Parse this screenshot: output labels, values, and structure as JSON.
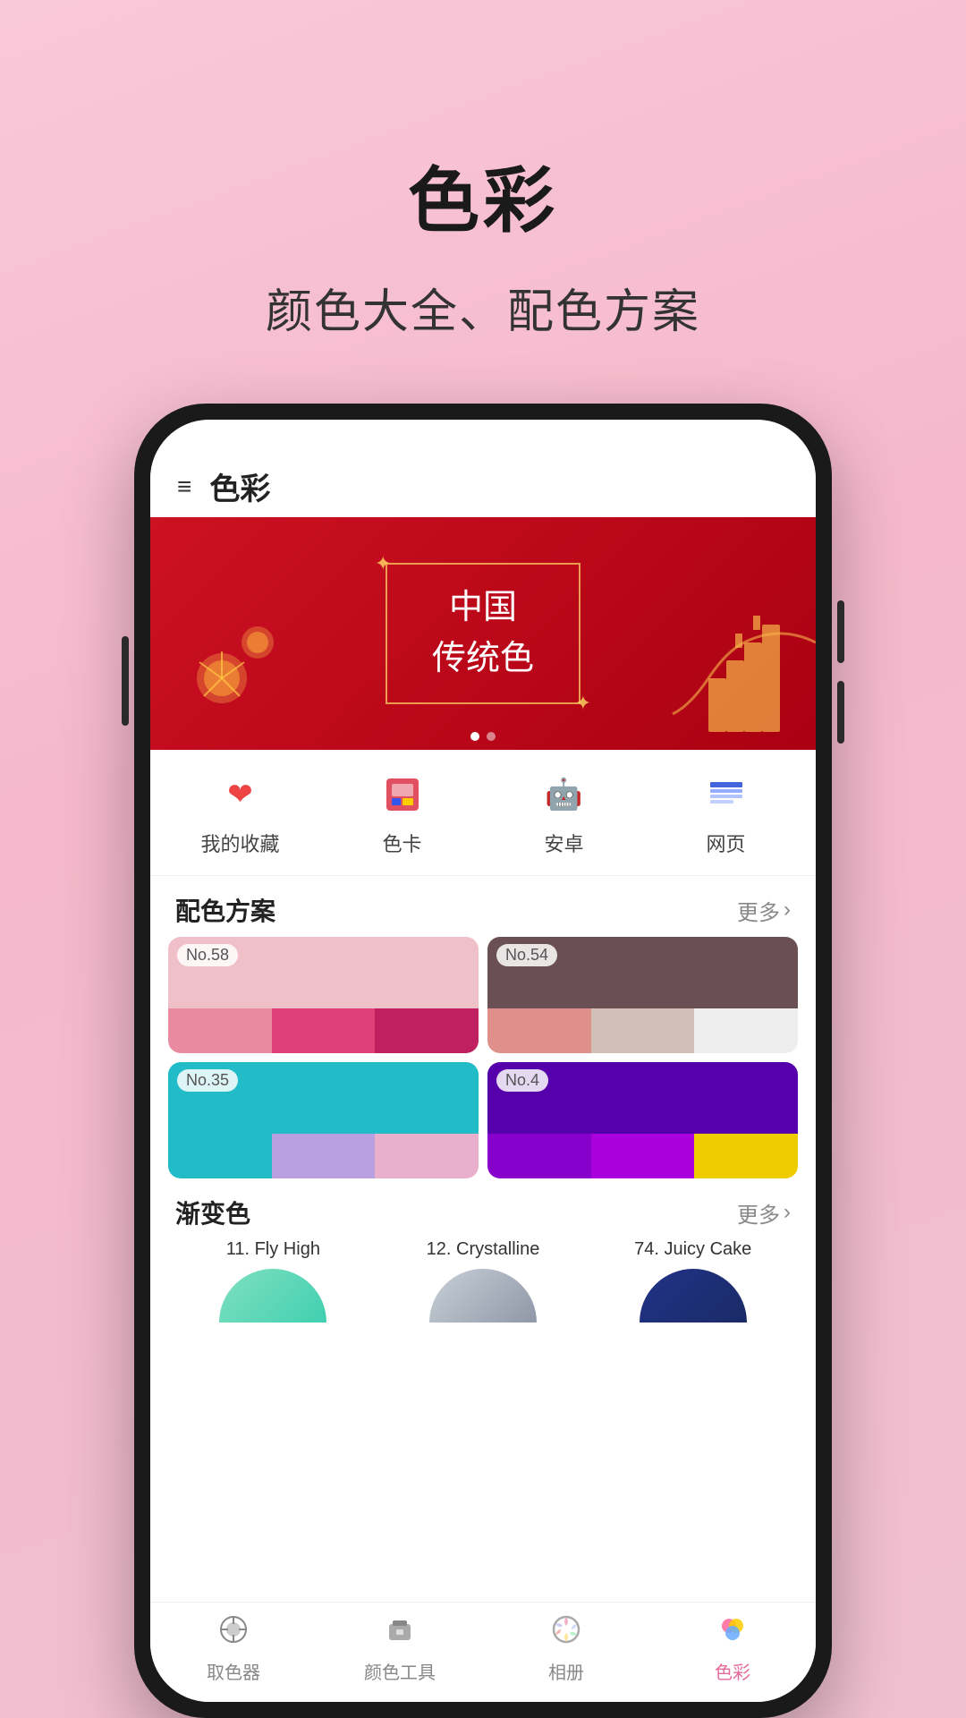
{
  "page": {
    "title": "色彩",
    "subtitle": "颜色大全、配色方案"
  },
  "header": {
    "title": "色彩",
    "menu_icon": "≡"
  },
  "banner": {
    "title_line1": "中国",
    "title_line2": "传统色",
    "dots": [
      true,
      false
    ]
  },
  "nav_items": [
    {
      "id": "favorites",
      "icon": "❤",
      "label": "我的收藏",
      "color": "#e44"
    },
    {
      "id": "color_card",
      "icon": "🎨",
      "label": "色卡",
      "color": "#e55"
    },
    {
      "id": "android",
      "icon": "🤖",
      "label": "安卓",
      "color": "#3a3"
    },
    {
      "id": "web",
      "icon": "🌐",
      "label": "网页",
      "color": "#44e"
    }
  ],
  "color_scheme": {
    "title": "配色方案",
    "more_label": "更多",
    "cards": [
      {
        "id": "no58",
        "label": "No.58",
        "top_color": "#f0c0c8",
        "bottom_colors": [
          "#e88aa0",
          "#e0407a",
          "#c02060"
        ]
      },
      {
        "id": "no54",
        "label": "No.54",
        "top_color": "#6a5055",
        "bottom_colors": [
          "#e0908a",
          "#d0c0b8",
          "#eeeeee"
        ]
      },
      {
        "id": "no35",
        "label": "No.35",
        "top_color": "#22bbc8",
        "bottom_colors": [
          "#22bbc8",
          "#b8a0e0",
          "#e8b0cc"
        ]
      },
      {
        "id": "no4",
        "label": "No.4",
        "top_color": "#5500aa",
        "bottom_colors": [
          "#8800cc",
          "#aa00dd",
          "#eecc00"
        ]
      }
    ]
  },
  "gradient_section": {
    "title": "渐变色",
    "more_label": "更多",
    "items": [
      {
        "id": "fly_high",
        "label": "11. Fly High",
        "gradient_start": "#80e0c0",
        "gradient_end": "#40c8a0"
      },
      {
        "id": "crystalline",
        "label": "12. Crystalline",
        "gradient_start": "#c8d0d8",
        "gradient_end": "#a0aab8"
      },
      {
        "id": "juicy_cake",
        "label": "74. Juicy Cake",
        "gradient_start": "#2244aa",
        "gradient_end": "#334488"
      }
    ]
  },
  "bottom_nav": {
    "items": [
      {
        "id": "color_picker",
        "icon": "🎨",
        "label": "取色器",
        "active": false
      },
      {
        "id": "color_tools",
        "icon": "🧰",
        "label": "颜色工具",
        "active": false
      },
      {
        "id": "album",
        "icon": "💎",
        "label": "相册",
        "active": false
      },
      {
        "id": "color",
        "icon": "🍭",
        "label": "色彩",
        "active": true
      }
    ]
  }
}
